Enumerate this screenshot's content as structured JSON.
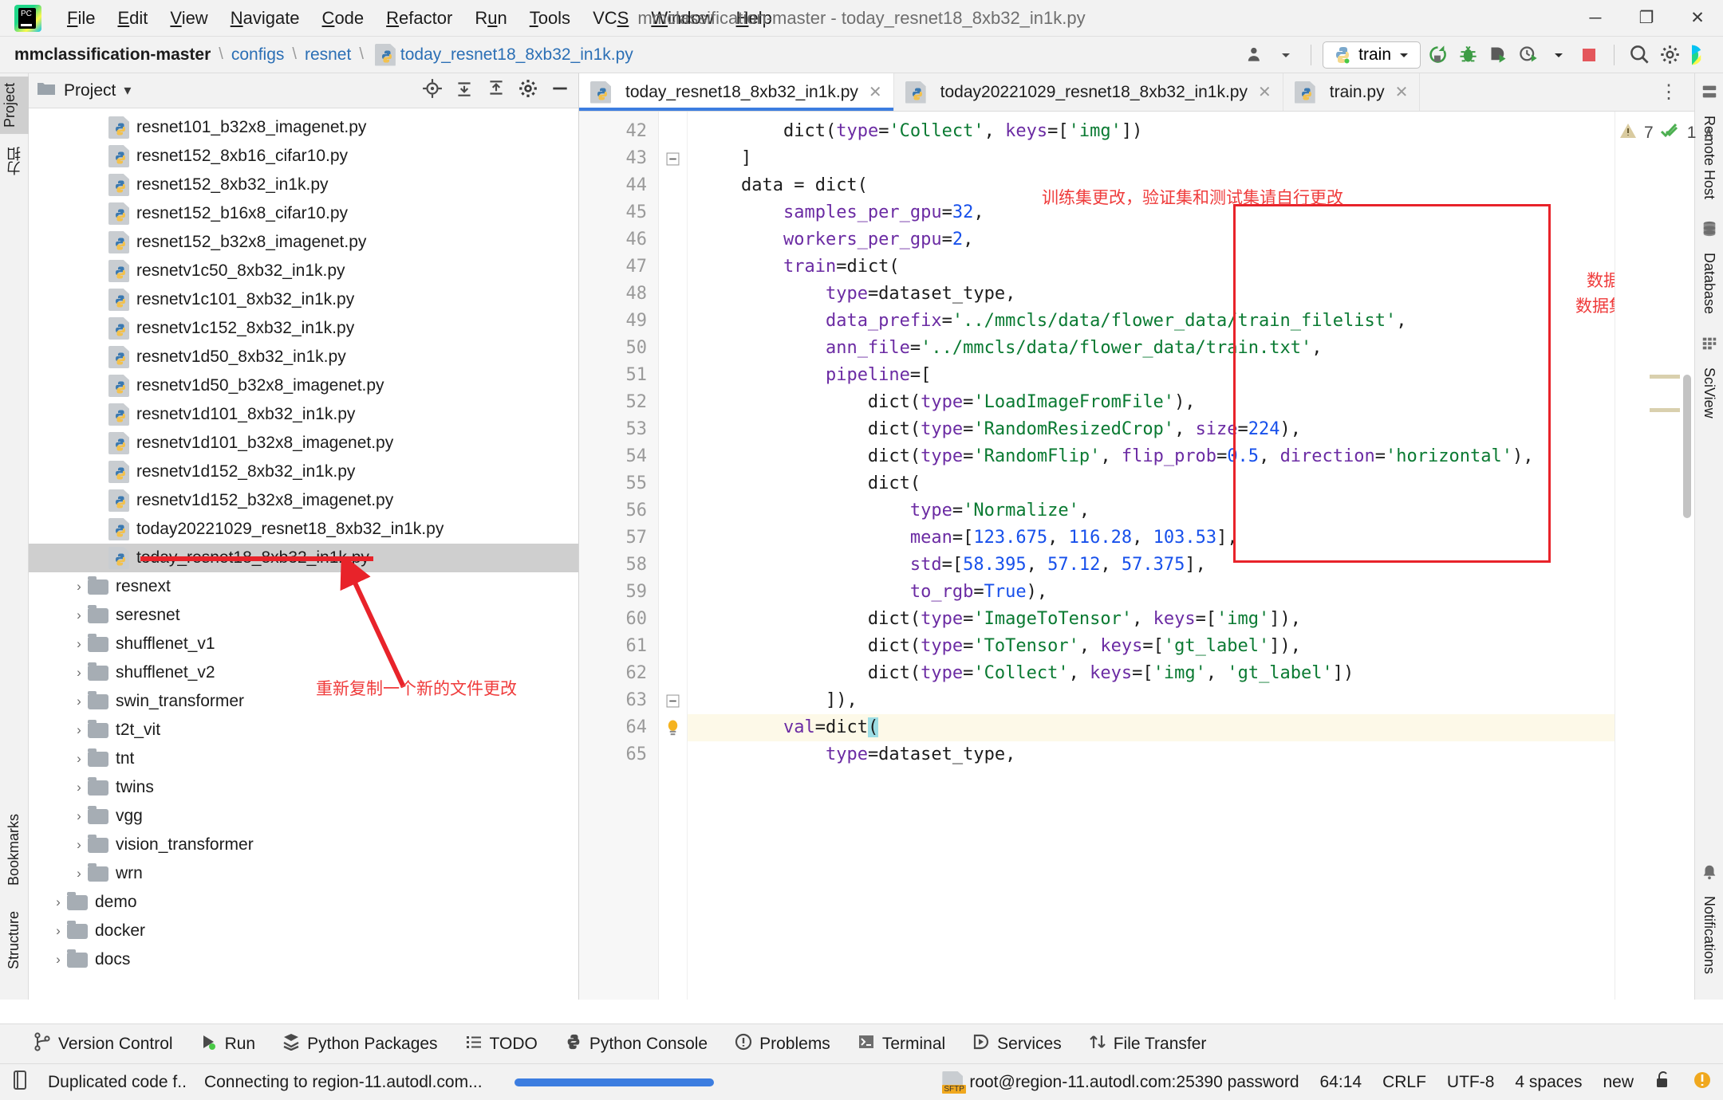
{
  "window": {
    "title": "mmclassification-master - today_resnet18_8xb32_in1k.py",
    "logo_text": "PC",
    "minimize": "─",
    "maximize": "❐",
    "close": "✕"
  },
  "menubar": [
    {
      "label": "File",
      "mnemonic": "F"
    },
    {
      "label": "Edit",
      "mnemonic": "E"
    },
    {
      "label": "View",
      "mnemonic": "V"
    },
    {
      "label": "Navigate",
      "mnemonic": "N"
    },
    {
      "label": "Code",
      "mnemonic": "C"
    },
    {
      "label": "Refactor",
      "mnemonic": "R"
    },
    {
      "label": "Run",
      "mnemonic": "u"
    },
    {
      "label": "Tools",
      "mnemonic": "T"
    },
    {
      "label": "VCS",
      "mnemonic": "S"
    },
    {
      "label": "Window",
      "mnemonic": "W"
    },
    {
      "label": "Help",
      "mnemonic": "H"
    }
  ],
  "breadcrumb": {
    "items": [
      "mmclassification-master",
      "configs",
      "resnet",
      "today_resnet18_8xb32_in1k.py"
    ],
    "separator": "\\"
  },
  "toolbar": {
    "run_config": "train",
    "icons": [
      "user-avatar-icon",
      "rerun-icon",
      "debug-icon",
      "coverage-icon",
      "profile-icon",
      "stop-icon",
      "search-everywhere-icon",
      "settings-icon",
      "pycharm-extra-icon"
    ]
  },
  "left_rail": {
    "project_tab": "Project",
    "structure_tab": "Structure",
    "bookmarks_tab": "Bookmarks",
    "cn_tab": "力扣"
  },
  "right_rail": {
    "tabs": [
      "Remote Host",
      "Database",
      "SciView",
      "Notifications"
    ]
  },
  "project_panel": {
    "title": "Project",
    "dropdown": "▾",
    "actions": [
      "locate-icon",
      "collapse-all-icon",
      "expand-all-icon",
      "settings-icon",
      "hide-icon"
    ],
    "tree": [
      {
        "label": "resnet101_b32x8_imagenet.py",
        "type": "py",
        "indent": 3
      },
      {
        "label": "resnet152_8xb16_cifar10.py",
        "type": "py",
        "indent": 3
      },
      {
        "label": "resnet152_8xb32_in1k.py",
        "type": "py",
        "indent": 3
      },
      {
        "label": "resnet152_b16x8_cifar10.py",
        "type": "py",
        "indent": 3
      },
      {
        "label": "resnet152_b32x8_imagenet.py",
        "type": "py",
        "indent": 3
      },
      {
        "label": "resnetv1c50_8xb32_in1k.py",
        "type": "py",
        "indent": 3
      },
      {
        "label": "resnetv1c101_8xb32_in1k.py",
        "type": "py",
        "indent": 3
      },
      {
        "label": "resnetv1c152_8xb32_in1k.py",
        "type": "py",
        "indent": 3
      },
      {
        "label": "resnetv1d50_8xb32_in1k.py",
        "type": "py",
        "indent": 3
      },
      {
        "label": "resnetv1d50_b32x8_imagenet.py",
        "type": "py",
        "indent": 3
      },
      {
        "label": "resnetv1d101_8xb32_in1k.py",
        "type": "py",
        "indent": 3
      },
      {
        "label": "resnetv1d101_b32x8_imagenet.py",
        "type": "py",
        "indent": 3
      },
      {
        "label": "resnetv1d152_8xb32_in1k.py",
        "type": "py",
        "indent": 3
      },
      {
        "label": "resnetv1d152_b32x8_imagenet.py",
        "type": "py",
        "indent": 3
      },
      {
        "label": "today20221029_resnet18_8xb32_in1k.py",
        "type": "py",
        "indent": 3
      },
      {
        "label": "today_resnet18_8xb32_in1k.py",
        "type": "py",
        "indent": 3,
        "selected": true
      },
      {
        "label": "resnext",
        "type": "folder",
        "indent": 2
      },
      {
        "label": "seresnet",
        "type": "folder",
        "indent": 2
      },
      {
        "label": "shufflenet_v1",
        "type": "folder",
        "indent": 2
      },
      {
        "label": "shufflenet_v2",
        "type": "folder",
        "indent": 2
      },
      {
        "label": "swin_transformer",
        "type": "folder",
        "indent": 2
      },
      {
        "label": "t2t_vit",
        "type": "folder",
        "indent": 2
      },
      {
        "label": "tnt",
        "type": "folder",
        "indent": 2
      },
      {
        "label": "twins",
        "type": "folder",
        "indent": 2
      },
      {
        "label": "vgg",
        "type": "folder",
        "indent": 2
      },
      {
        "label": "vision_transformer",
        "type": "folder",
        "indent": 2
      },
      {
        "label": "wrn",
        "type": "folder",
        "indent": 2
      },
      {
        "label": "demo",
        "type": "folder",
        "indent": 1
      },
      {
        "label": "docker",
        "type": "folder",
        "indent": 1
      },
      {
        "label": "docs",
        "type": "folder",
        "indent": 1
      }
    ]
  },
  "editor": {
    "tabs": [
      {
        "label": "today_resnet18_8xb32_in1k.py",
        "active": true,
        "close": "✕"
      },
      {
        "label": "today20221029_resnet18_8xb32_in1k.py",
        "active": false,
        "close": "✕"
      },
      {
        "label": "train.py",
        "active": false,
        "close": "✕"
      }
    ],
    "more_icon": "⋮",
    "inspection": {
      "warning_count": "7",
      "ok_count": "1",
      "up_arrow": "∧",
      "down_arrow": "∨"
    },
    "line_numbers": [
      "42",
      "43",
      "44",
      "45",
      "46",
      "47",
      "48",
      "49",
      "50",
      "51",
      "52",
      "53",
      "54",
      "55",
      "56",
      "57",
      "58",
      "59",
      "60",
      "61",
      "62",
      "63",
      "64",
      "65"
    ],
    "lines": [
      {
        "n": "42",
        "indent": 8,
        "segments": [
          {
            "t": "dict(",
            "c": "pln"
          },
          {
            "t": "type",
            "c": "kw"
          },
          {
            "t": "=",
            "c": "pln"
          },
          {
            "t": "'Collect'",
            "c": "str"
          },
          {
            "t": ", ",
            "c": "pln"
          },
          {
            "t": "keys",
            "c": "kw"
          },
          {
            "t": "=[",
            "c": "pln"
          },
          {
            "t": "'img'",
            "c": "str"
          },
          {
            "t": "])",
            "c": "pln"
          }
        ]
      },
      {
        "n": "43",
        "indent": 4,
        "segments": [
          {
            "t": "]",
            "c": "pln"
          }
        ]
      },
      {
        "n": "44",
        "indent": 4,
        "segments": [
          {
            "t": "data = dict(",
            "c": "pln"
          }
        ]
      },
      {
        "n": "45",
        "indent": 8,
        "segments": [
          {
            "t": "samples_per_gpu",
            "c": "kw"
          },
          {
            "t": "=",
            "c": "pln"
          },
          {
            "t": "32",
            "c": "num"
          },
          {
            "t": ",",
            "c": "pln"
          }
        ]
      },
      {
        "n": "46",
        "indent": 8,
        "segments": [
          {
            "t": "workers_per_gpu",
            "c": "kw"
          },
          {
            "t": "=",
            "c": "pln"
          },
          {
            "t": "2",
            "c": "num"
          },
          {
            "t": ",",
            "c": "pln"
          }
        ]
      },
      {
        "n": "47",
        "indent": 8,
        "segments": [
          {
            "t": "train",
            "c": "kw"
          },
          {
            "t": "=dict(",
            "c": "pln"
          }
        ]
      },
      {
        "n": "48",
        "indent": 12,
        "segments": [
          {
            "t": "type",
            "c": "kw"
          },
          {
            "t": "=dataset_type,",
            "c": "pln"
          }
        ]
      },
      {
        "n": "49",
        "indent": 12,
        "segments": [
          {
            "t": "data_prefix",
            "c": "kw"
          },
          {
            "t": "=",
            "c": "pln"
          },
          {
            "t": "'../mmcls/data/flower_data/train_filelist'",
            "c": "str"
          },
          {
            "t": ",",
            "c": "pln"
          }
        ]
      },
      {
        "n": "50",
        "indent": 12,
        "segments": [
          {
            "t": "ann_file",
            "c": "kw"
          },
          {
            "t": "=",
            "c": "pln"
          },
          {
            "t": "'../mmcls/data/flower_data/train.txt'",
            "c": "str"
          },
          {
            "t": ",",
            "c": "pln"
          }
        ]
      },
      {
        "n": "51",
        "indent": 12,
        "segments": [
          {
            "t": "pipeline",
            "c": "kw"
          },
          {
            "t": "=[",
            "c": "pln"
          }
        ]
      },
      {
        "n": "52",
        "indent": 16,
        "segments": [
          {
            "t": "dict(",
            "c": "pln"
          },
          {
            "t": "type",
            "c": "kw"
          },
          {
            "t": "=",
            "c": "pln"
          },
          {
            "t": "'LoadImageFromFile'",
            "c": "str"
          },
          {
            "t": "),",
            "c": "pln"
          }
        ]
      },
      {
        "n": "53",
        "indent": 16,
        "segments": [
          {
            "t": "dict(",
            "c": "pln"
          },
          {
            "t": "type",
            "c": "kw"
          },
          {
            "t": "=",
            "c": "pln"
          },
          {
            "t": "'RandomResizedCrop'",
            "c": "str"
          },
          {
            "t": ", ",
            "c": "pln"
          },
          {
            "t": "size",
            "c": "kw"
          },
          {
            "t": "=",
            "c": "pln"
          },
          {
            "t": "224",
            "c": "num"
          },
          {
            "t": "),",
            "c": "pln"
          }
        ]
      },
      {
        "n": "54",
        "indent": 16,
        "segments": [
          {
            "t": "dict(",
            "c": "pln"
          },
          {
            "t": "type",
            "c": "kw"
          },
          {
            "t": "=",
            "c": "pln"
          },
          {
            "t": "'RandomFlip'",
            "c": "str"
          },
          {
            "t": ", ",
            "c": "pln"
          },
          {
            "t": "flip_prob",
            "c": "kw"
          },
          {
            "t": "=",
            "c": "pln"
          },
          {
            "t": "0.5",
            "c": "num"
          },
          {
            "t": ", ",
            "c": "pln"
          },
          {
            "t": "direction",
            "c": "kw"
          },
          {
            "t": "=",
            "c": "pln"
          },
          {
            "t": "'horizontal'",
            "c": "str"
          },
          {
            "t": "),",
            "c": "pln"
          }
        ]
      },
      {
        "n": "55",
        "indent": 16,
        "segments": [
          {
            "t": "dict(",
            "c": "pln"
          }
        ]
      },
      {
        "n": "56",
        "indent": 20,
        "segments": [
          {
            "t": "type",
            "c": "kw"
          },
          {
            "t": "=",
            "c": "pln"
          },
          {
            "t": "'Normalize'",
            "c": "str"
          },
          {
            "t": ",",
            "c": "pln"
          }
        ]
      },
      {
        "n": "57",
        "indent": 20,
        "segments": [
          {
            "t": "mean",
            "c": "kw"
          },
          {
            "t": "=[",
            "c": "pln"
          },
          {
            "t": "123.675",
            "c": "num"
          },
          {
            "t": ", ",
            "c": "pln"
          },
          {
            "t": "116.28",
            "c": "num"
          },
          {
            "t": ", ",
            "c": "pln"
          },
          {
            "t": "103.53",
            "c": "num"
          },
          {
            "t": "],",
            "c": "pln"
          }
        ]
      },
      {
        "n": "58",
        "indent": 20,
        "segments": [
          {
            "t": "std",
            "c": "kw"
          },
          {
            "t": "=[",
            "c": "pln"
          },
          {
            "t": "58.395",
            "c": "num"
          },
          {
            "t": ", ",
            "c": "pln"
          },
          {
            "t": "57.12",
            "c": "num"
          },
          {
            "t": ", ",
            "c": "pln"
          },
          {
            "t": "57.375",
            "c": "num"
          },
          {
            "t": "],",
            "c": "pln"
          }
        ]
      },
      {
        "n": "59",
        "indent": 20,
        "segments": [
          {
            "t": "to_rgb",
            "c": "kw"
          },
          {
            "t": "=",
            "c": "pln"
          },
          {
            "t": "True",
            "c": "num"
          },
          {
            "t": "),",
            "c": "pln"
          }
        ]
      },
      {
        "n": "60",
        "indent": 16,
        "segments": [
          {
            "t": "dict(",
            "c": "pln"
          },
          {
            "t": "type",
            "c": "kw"
          },
          {
            "t": "=",
            "c": "pln"
          },
          {
            "t": "'ImageToTensor'",
            "c": "str"
          },
          {
            "t": ", ",
            "c": "pln"
          },
          {
            "t": "keys",
            "c": "kw"
          },
          {
            "t": "=[",
            "c": "pln"
          },
          {
            "t": "'img'",
            "c": "str"
          },
          {
            "t": "]),",
            "c": "pln"
          }
        ]
      },
      {
        "n": "61",
        "indent": 16,
        "segments": [
          {
            "t": "dict(",
            "c": "pln"
          },
          {
            "t": "type",
            "c": "kw"
          },
          {
            "t": "=",
            "c": "pln"
          },
          {
            "t": "'ToTensor'",
            "c": "str"
          },
          {
            "t": ", ",
            "c": "pln"
          },
          {
            "t": "keys",
            "c": "kw"
          },
          {
            "t": "=[",
            "c": "pln"
          },
          {
            "t": "'gt_label'",
            "c": "str"
          },
          {
            "t": "]),",
            "c": "pln"
          }
        ]
      },
      {
        "n": "62",
        "indent": 16,
        "segments": [
          {
            "t": "dict(",
            "c": "pln"
          },
          {
            "t": "type",
            "c": "kw"
          },
          {
            "t": "=",
            "c": "pln"
          },
          {
            "t": "'Collect'",
            "c": "str"
          },
          {
            "t": ", ",
            "c": "pln"
          },
          {
            "t": "keys",
            "c": "kw"
          },
          {
            "t": "=[",
            "c": "pln"
          },
          {
            "t": "'img'",
            "c": "str"
          },
          {
            "t": ", ",
            "c": "pln"
          },
          {
            "t": "'gt_label'",
            "c": "str"
          },
          {
            "t": "])",
            "c": "pln"
          }
        ]
      },
      {
        "n": "63",
        "indent": 12,
        "segments": [
          {
            "t": "]),",
            "c": "pln"
          }
        ]
      },
      {
        "n": "64",
        "indent": 8,
        "highlight": true,
        "bulb": true,
        "segments": [
          {
            "t": "val",
            "c": "kw"
          },
          {
            "t": "=dict",
            "c": "pln"
          },
          {
            "t": "(",
            "c": "cursor"
          }
        ]
      },
      {
        "n": "65",
        "indent": 12,
        "segments": [
          {
            "t": "type",
            "c": "kw"
          },
          {
            "t": "=dataset_type,",
            "c": "pln"
          }
        ]
      }
    ],
    "annotations": [
      {
        "id": "note-train-set",
        "text": "训练集更改，验证集和测试集请自行更改"
      },
      {
        "id": "note-dataset-path",
        "text": "数据集路径"
      },
      {
        "id": "note-dataset-label-path",
        "text": "数据集标签路径"
      },
      {
        "id": "note-recopy",
        "text": "重新复制一个新的文件更改"
      }
    ]
  },
  "tool_window_bar": [
    {
      "label": "Version Control",
      "icon": "branch-icon"
    },
    {
      "label": "Run",
      "icon": "run-icon"
    },
    {
      "label": "Python Packages",
      "icon": "packages-icon"
    },
    {
      "label": "TODO",
      "icon": "todo-icon"
    },
    {
      "label": "Python Console",
      "icon": "python-icon"
    },
    {
      "label": "Problems",
      "icon": "problems-icon"
    },
    {
      "label": "Terminal",
      "icon": "terminal-icon"
    },
    {
      "label": "Services",
      "icon": "services-icon"
    },
    {
      "label": "File Transfer",
      "icon": "file-transfer-icon"
    }
  ],
  "status_bar": {
    "inspection_text": "Duplicated code f..",
    "progress_text": "Connecting to region-11.autodl.com...",
    "sftp_label": "SFTP",
    "remote": "root@region-11.autodl.com:25390 password",
    "caret": "64:14",
    "line_sep": "CRLF",
    "encoding": "UTF-8",
    "indent": "4 spaces",
    "branch": "new",
    "lock_icon": "lock-icon"
  },
  "colors": {
    "accent": "#3c7de0",
    "annotation_red": "#ef3b3b",
    "box_red": "#e8232a",
    "keyword": "#6b2ba3",
    "string": "#0a7a32",
    "number": "#1750eb"
  }
}
